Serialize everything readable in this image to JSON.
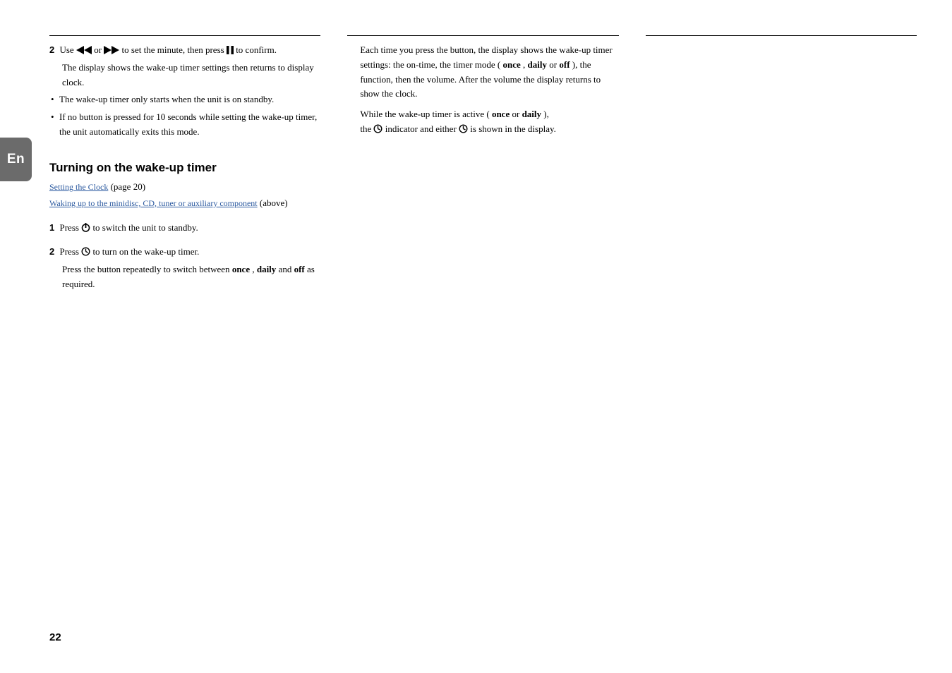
{
  "lang_tab": "En",
  "page_number": "22",
  "col1": {
    "step2_num": "2",
    "step2_text_a": "Use ",
    "step2_text_b": " or ",
    "step2_text_c": " to set the minute, then press ",
    "step2_text_d": " to confirm.",
    "step2_note": "The display shows the wake-up timer settings then returns to display clock.",
    "bullet1": "The wake-up timer only starts when the unit is on standby.",
    "bullet2": "If no button is pressed for 10 seconds while setting the wake-up timer, the unit automatically exits this mode.",
    "section_title": "Turning on the wake-up timer",
    "sub1": "Setting the Clock",
    "sub2": " (page 20)",
    "sub3": "Waking up to the minidisc, CD, tuner or auxiliary component",
    "sub4": " (above)",
    "step1_num": "1",
    "step1_text_a": "Press ",
    "step1_text_b": " to switch the unit to standby.",
    "step2b_num": "2",
    "step2b_text_a": "Press ",
    "step2b_text_b": " to turn on the wake-up timer.",
    "step2b_note_a": "Press the button repeatedly to switch between ",
    "step2b_note_b": "once",
    "step2b_note_c": ", ",
    "step2b_note_d": "daily",
    "step2b_note_e": " and ",
    "step2b_note_f": "off",
    "step2b_note_g": " as required."
  },
  "col2": {
    "line1_a": "Each time you press the button, the display shows the wake-up timer settings: the on-time, the timer mode (",
    "line1_b": "once",
    "line1_c": ", ",
    "line1_d": "daily",
    "line1_e": " or ",
    "line1_f": "off",
    "line1_g": "), the function, then the volume. After the volume the display returns to show the clock.",
    "para2_a": "While the wake-up timer is active (",
    "para2_b": "once",
    "para2_c": " or ",
    "para2_d": "daily",
    "para2_e": "),",
    "para3_a": "the ",
    "para3_b": " indicator and either ",
    "para3_c": " is shown in the display."
  }
}
